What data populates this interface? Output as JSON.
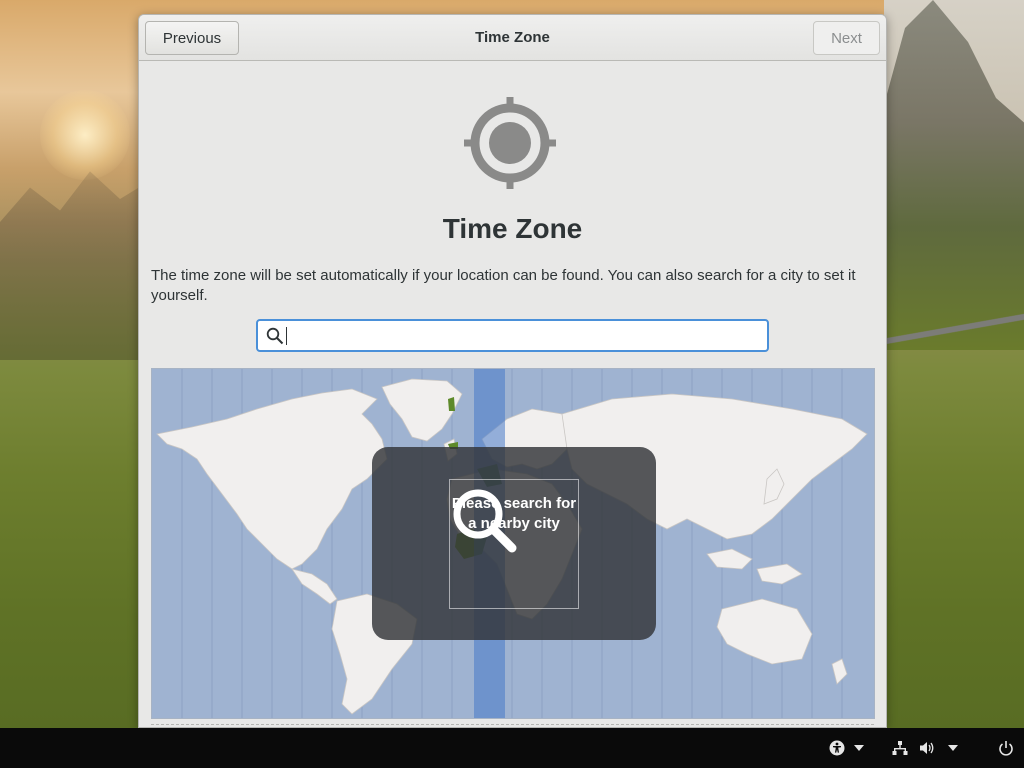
{
  "window": {
    "title": "Time Zone",
    "previous_label": "Previous",
    "next_label": "Next"
  },
  "page": {
    "heading": "Time Zone",
    "description": "The time zone will be set automatically if your location can be found. You can also search for a city to set it yourself.",
    "location_icon": "location-crosshair-icon"
  },
  "search": {
    "value": "",
    "placeholder": "",
    "icon": "search-icon"
  },
  "map": {
    "overlay_text_line1": "Please search for",
    "overlay_text_line2": "a nearby city",
    "overlay_icon": "search-icon"
  },
  "panel": {
    "icons": [
      "accessibility-icon",
      "dropdown-arrow-icon",
      "network-icon",
      "volume-icon",
      "dropdown-arrow-icon",
      "power-icon"
    ]
  },
  "colors": {
    "accent": "#4a90d9",
    "map_ocean": "#9fb3d1",
    "map_land": "#f1efee",
    "overlay": "#323438",
    "panel": "#0a0a0a"
  }
}
